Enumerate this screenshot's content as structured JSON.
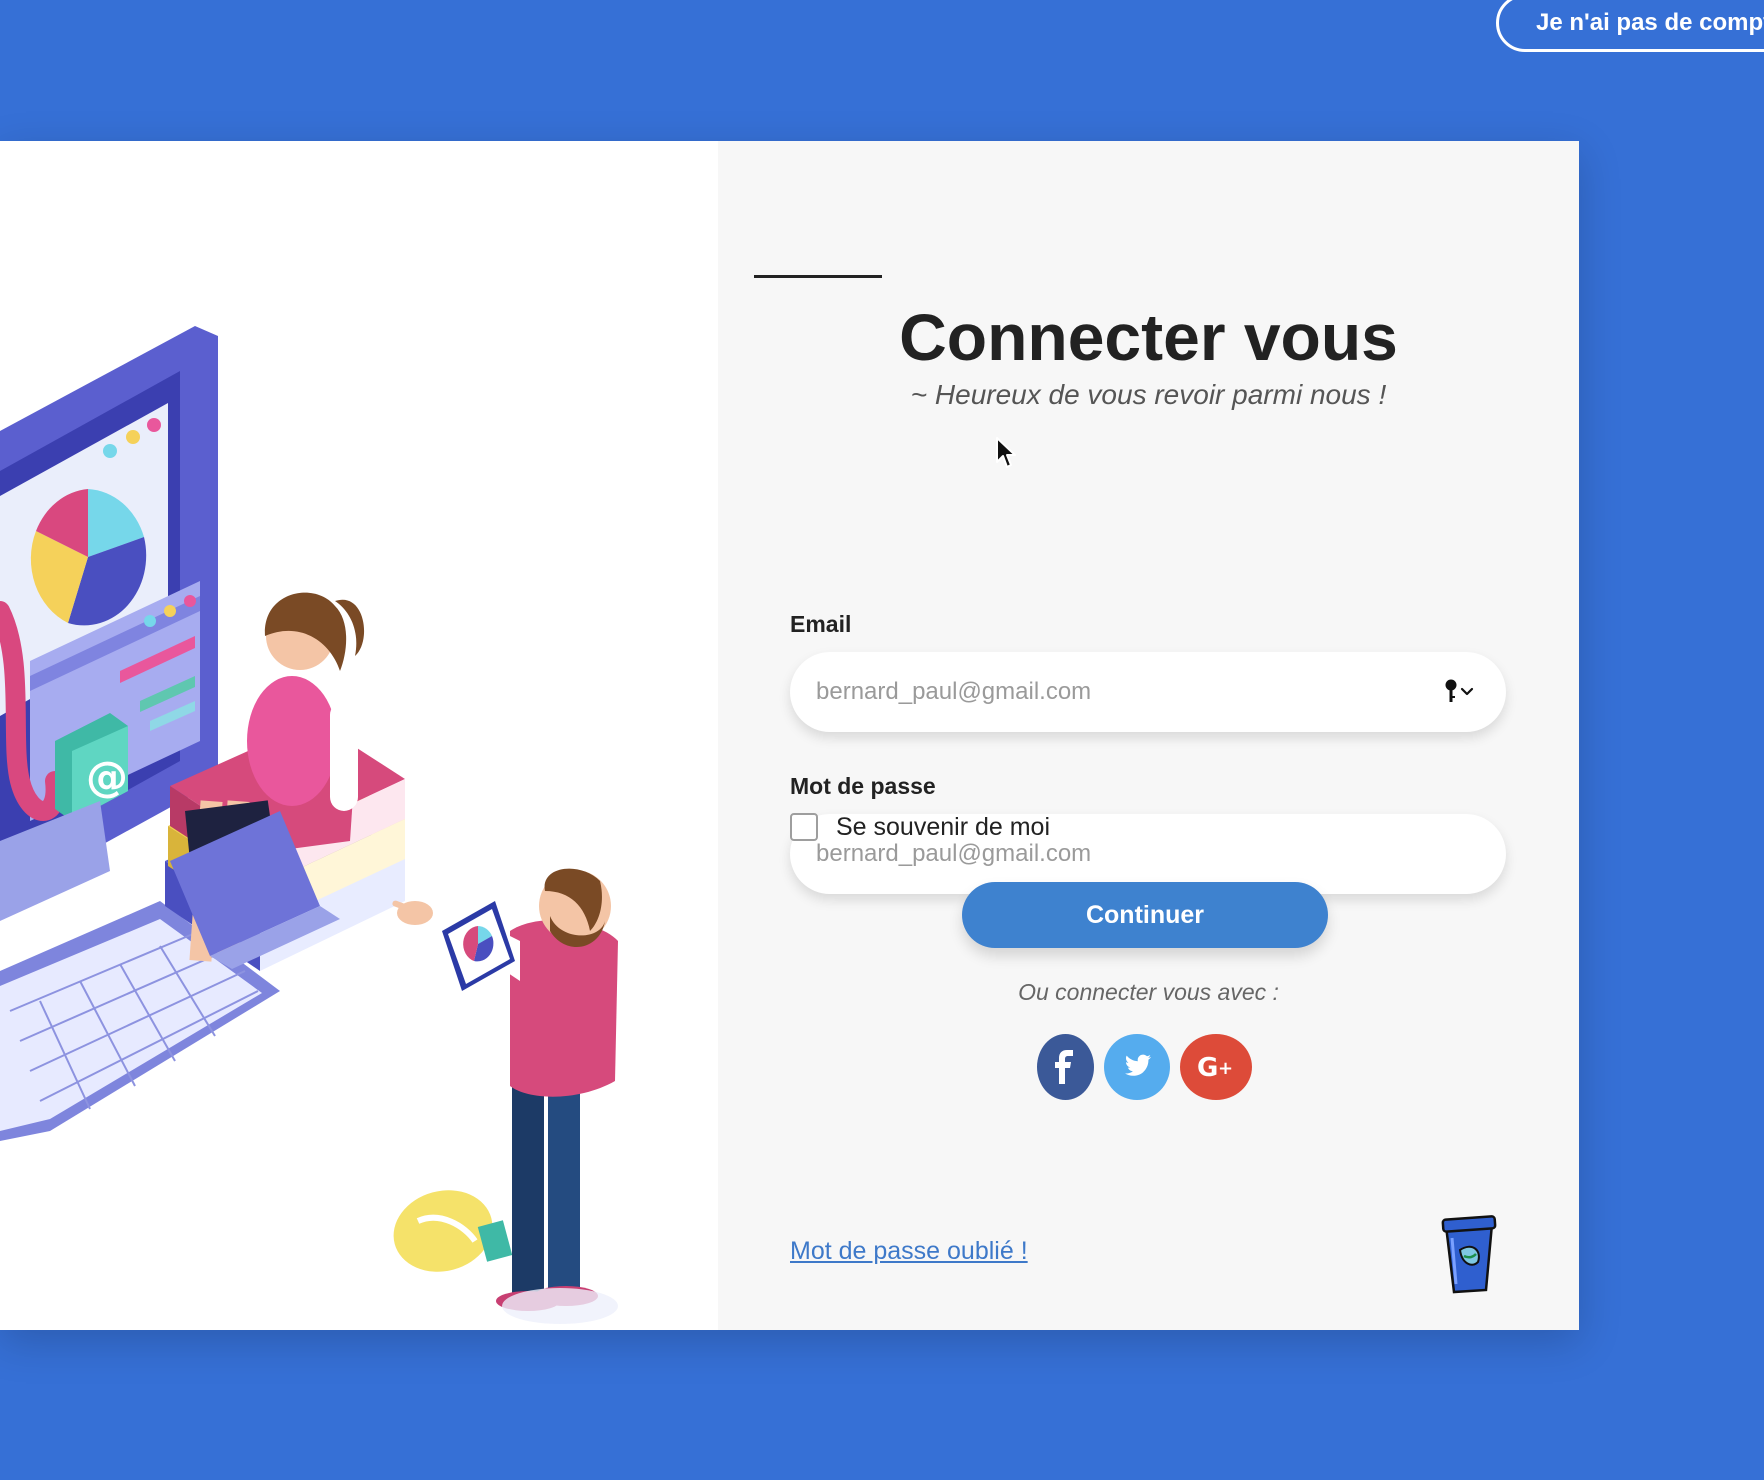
{
  "topbar": {
    "signup_label": "Je n'ai pas de compte"
  },
  "login": {
    "title": "Connecter vous",
    "subtitle": "~ Heureux de vous revoir parmi nous !",
    "email": {
      "label": "Email",
      "value": "",
      "placeholder": "bernard_paul@gmail.com"
    },
    "password": {
      "label": "Mot de passe",
      "value": "",
      "placeholder": "bernard_paul@gmail.com"
    },
    "remember": {
      "label": "Se souvenir de moi",
      "checked": false
    },
    "continue_label": "Continuer",
    "alt_login_text": "Ou connecter vous avec :",
    "social": [
      {
        "name": "facebook",
        "icon": "facebook-icon",
        "color": "#3b5998"
      },
      {
        "name": "twitter",
        "icon": "twitter-icon",
        "color": "#55acee"
      },
      {
        "name": "google-plus",
        "icon": "google-plus-icon",
        "color": "#dd4b39"
      }
    ],
    "forgot_label": "Mot de passe oublié !"
  },
  "colors": {
    "background": "#3670d6",
    "button": "#3e82cf",
    "link": "#3e79c9",
    "form_panel": "#f7f7f7"
  },
  "icons": [
    "password-key-icon",
    "chevron-down-icon",
    "facebook-icon",
    "twitter-icon",
    "google-plus-icon",
    "cup-icon",
    "mouse-cursor-icon"
  ]
}
